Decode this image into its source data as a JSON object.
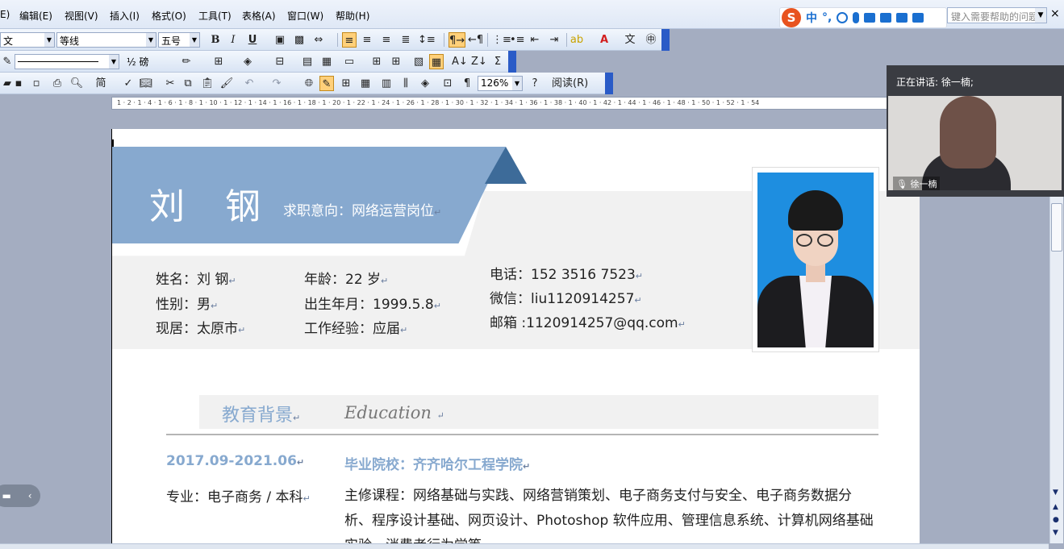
{
  "menubar": {
    "items": [
      {
        "label": "E)"
      },
      {
        "label": "编辑(E)"
      },
      {
        "label": "视图(V)"
      },
      {
        "label": "插入(I)"
      },
      {
        "label": "格式(O)"
      },
      {
        "label": "工具(T)"
      },
      {
        "label": "表格(A)"
      },
      {
        "label": "窗口(W)"
      },
      {
        "label": "帮助(H)"
      }
    ],
    "help_placeholder": "键入需要帮助的问题",
    "close": "×"
  },
  "ime": {
    "logo": "S",
    "mode": "中",
    "punct": "°,"
  },
  "format_toolbar": {
    "style_value": "文",
    "font_value": "等线",
    "size_value": "五号",
    "bold": "B",
    "italic": "I",
    "underline": "U"
  },
  "drawing_toolbar": {
    "line_weight": "½ 磅"
  },
  "standard_toolbar": {
    "simplified": "简",
    "zoom_value": "126%",
    "read_label": "阅读(R)"
  },
  "ruler": {
    "ticks": "1 · 2 · 1 · 4 · 1 · 6 · 1 · 8 · 1 · 10 · 1 · 12 · 1 · 14 · 1 · 16 · 1 · 18 · 1 · 20 · 1 · 22 · 1 · 24 · 1 · 26 · 1 · 28 · 1 · 30 · 1 · 32 · 1 · 34 · 1 · 36 · 1 · 38 · 1 · 40 · 1 · 42 · 1 · 44 · 1 · 46 · 1 · 48 · 1 · 50 · 1 · 52 · 1 · 54"
  },
  "resume": {
    "name": "刘 钢",
    "intent": "求职意向：网络运营岗位",
    "info": {
      "name_line": "姓名：刘 钢",
      "gender": "性别：男",
      "residence": "现居：太原市",
      "age": "年龄：22 岁",
      "birth": "出生年月：1999.5.8",
      "experience": "工作经验：应届",
      "phone": "电话：152 3516 7523",
      "wechat": "微信：liu1120914257",
      "email": "邮箱 :1120914257@qq.com"
    },
    "education": {
      "title_cn": "教育背景",
      "title_en": "Education",
      "date": "2017.09-2021.06",
      "school": "毕业院校：齐齐哈尔工程学院",
      "major": "专业：电子商务 / 本科",
      "courses": "主修课程：网络基础与实践、网络营销策划、电子商务支付与安全、电子商务数据分析、程序设计基础、网页设计、Photoshop 软件应用、管理信息系统、计算机网络基础实验、消费者行为学等"
    }
  },
  "video": {
    "speaking": "正在讲话: 徐一楠;",
    "speaker": "徐一楠"
  },
  "colors": {
    "accent": "#87a9cf",
    "dark_accent": "#3d6b99",
    "band": "#f1f1f1"
  }
}
